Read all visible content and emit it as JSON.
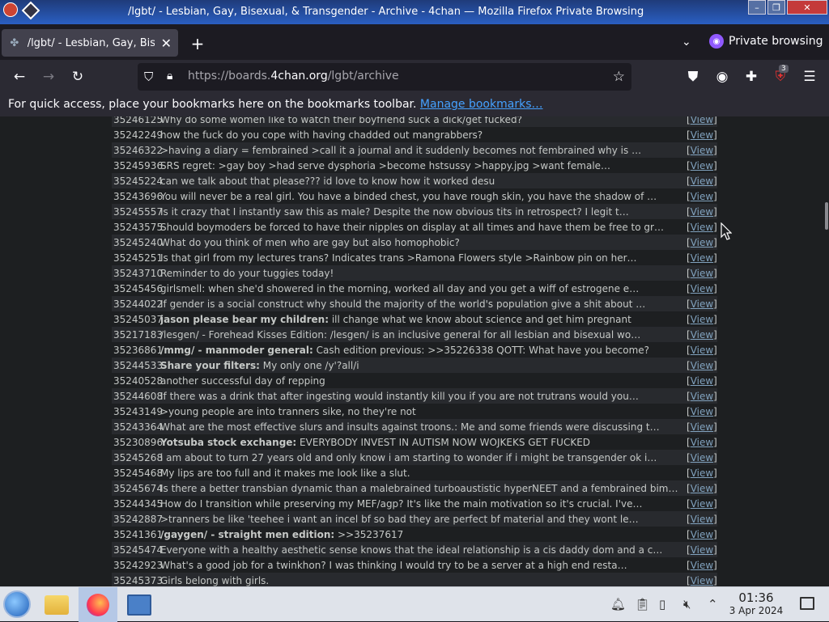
{
  "window": {
    "title": "/lgbt/ - Lesbian, Gay, Bisexual, & Transgender - Archive - 4chan — Mozilla Firefox Private Browsing",
    "controls": [
      "–",
      "❐",
      "✕"
    ]
  },
  "tabs": [
    {
      "label": "/lgbt/ - Lesbian, Gay, Bisexual, & Transgender - Archive",
      "close": "✕"
    }
  ],
  "tabstrip": {
    "new_tab": "+",
    "list_all": "⌄",
    "private_label": "Private browsing"
  },
  "nav": {
    "back": "←",
    "forward": "→",
    "reload": "↻",
    "url_prefix": "https://boards.",
    "url_domain": "4chan.org",
    "url_suffix": "/lgbt/archive",
    "extensions_badge": "3"
  },
  "bookmarks_bar": {
    "message": "For quick access, place your bookmarks here on the bookmarks toolbar.",
    "link": "Manage bookmarks…"
  },
  "archive": {
    "view_label": "View",
    "rows": [
      {
        "id": "35246125",
        "subject": "",
        "text": "Why do some women like to watch their boyfriend suck a dick/get fucked?"
      },
      {
        "id": "35242249",
        "subject": "",
        "text": "how the fuck do you cope with having chadded out mangrabbers?"
      },
      {
        "id": "35246322",
        "subject": "",
        "text": ">having a diary = fembrained >call it a journal and it suddenly becomes not fembrained why is …"
      },
      {
        "id": "35245936",
        "subject": "",
        "text": "SRS regret: >gay boy >had serve dysphoria >become hstsussy >happy.jpg >want female…"
      },
      {
        "id": "35245224",
        "subject": "",
        "text": "can we talk about that please??? id love to know how it worked desu"
      },
      {
        "id": "35243696",
        "subject": "",
        "text": "You will never be a real girl. You have a binded chest, you have rough skin, you have the shadow of …"
      },
      {
        "id": "35245557",
        "subject": "",
        "text": "Is it crazy that I instantly saw this as male? Despite the now obvious tits in retrospect? I legit t…"
      },
      {
        "id": "35243575",
        "subject": "",
        "text": "Should boymoders be forced to have their nipples on display at all times and have them be free to gr…"
      },
      {
        "id": "35245240",
        "subject": "",
        "text": "What do you think of men who are gay but also homophobic?"
      },
      {
        "id": "35245251",
        "subject": "",
        "text": "Is that girl from my lectures trans? Indicates trans >Ramona Flowers style >Rainbow pin on her…"
      },
      {
        "id": "35243710",
        "subject": "",
        "text": "Reminder to do your tuggies today!"
      },
      {
        "id": "35245456",
        "subject": "",
        "text": "girlsmell: when she'd showered in the morning, worked all day and you get a wiff of estrogene e…"
      },
      {
        "id": "35244022",
        "subject": "",
        "text": "If gender is a social construct why should the majority of the world's population give a shit about …"
      },
      {
        "id": "35245037",
        "subject": "jason please bear my children:",
        "text": " ill change what we know about science and get him pregnant"
      },
      {
        "id": "35217183",
        "subject": "",
        "text": "/lesgen/ - Forehead Kisses Edition: /lesgen/ is an inclusive general for all lesbian and bisexual wo…"
      },
      {
        "id": "35236861",
        "subject": "/mmg/ - manmoder general:",
        "text": " Cash edition previous: >>35226338 QOTT: What have you become?"
      },
      {
        "id": "35244533",
        "subject": "Share your filters:",
        "text": " My only one /y'?all/i"
      },
      {
        "id": "35240528",
        "subject": "",
        "text": "another successful day of repping"
      },
      {
        "id": "35244608",
        "subject": "",
        "text": "If there was a drink that after ingesting would instantly kill you if you are not trutrans would you…"
      },
      {
        "id": "35243149",
        "subject": "",
        "text": ">young people are into tranners sike, no they're not"
      },
      {
        "id": "35243364",
        "subject": "",
        "text": "What are the most effective slurs and insults against troons.: Me and some friends were discussing t…"
      },
      {
        "id": "35230896",
        "subject": "Yotsuba stock exchange:",
        "text": " EVERYBODY INVEST IN AUTISM NOW WOJKEKS GET FUCKED"
      },
      {
        "id": "35245268",
        "subject": "",
        "text": "i am about to turn 27 years old and only know i am starting to wonder if i might be transgender ok i…"
      },
      {
        "id": "35245468",
        "subject": "",
        "text": "My lips are too full and it makes me look like a slut."
      },
      {
        "id": "35245674",
        "subject": "",
        "text": "Is there a better transbian dynamic than a malebrained turboaustistic hyperNEET and a fembrained bim…"
      },
      {
        "id": "35244345",
        "subject": "",
        "text": "How do I transition while preserving my MEF/agp? It's like the main motivation so it's crucial. I've…"
      },
      {
        "id": "35242887",
        "subject": "",
        "text": ">tranners be like 'teehee i want an incel bf so bad they are perfect bf material and they wont le…"
      },
      {
        "id": "35241361",
        "subject": "/gaygen/ - straight men edition:",
        "text": " >>35237617"
      },
      {
        "id": "35245474",
        "subject": "",
        "text": "Everyone with a healthy aesthetic sense knows that the ideal relationship is a cis daddy dom and a c…"
      },
      {
        "id": "35242923",
        "subject": "",
        "text": "What's a good job for a twinkhon? I was thinking I would try to be a server at a high end resta…"
      },
      {
        "id": "35245373",
        "subject": "",
        "text": "Girls belong with girls."
      }
    ]
  },
  "taskbar": {
    "clock_time": "01:36",
    "clock_date": "3 Apr 2024"
  }
}
